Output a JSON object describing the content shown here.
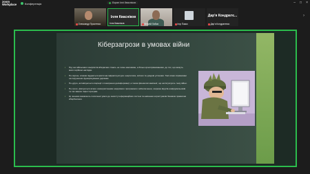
{
  "app": {
    "logo_line1": "zoom",
    "logo_line2": "Workplace",
    "meeting_label": "Конференція"
  },
  "share_notice": "Екран Іллі Квасніков",
  "participants": [
    {
      "name": "Олександр Простенко"
    },
    {
      "big_name": "Ілля Квасніков",
      "name": "Ілля Квасніков"
    },
    {
      "name": "Віталій Лобов"
    },
    {
      "name": "Ігор Пакко"
    },
    {
      "big_name": "Дар'я Кондратє...",
      "name": "Дар'я Кондратенко"
    }
  ],
  "slide": {
    "title": "Кіберзагрози в умовах війни",
    "bullets": [
      "Під час військових конфліктів кібератаки стають не лише масовими, а більш цілеспрямованими, до тих, що можуть мати серйозні наслідки.",
      "По-перше, атакам піддається критична інфраструктура: енергетика, зв'язок та урядові установи. Такі атаки спрямовані на порушення функціонування держави.",
      "По-друге, активізуються операції з поширення дезінформації, а також фішингові кампанії, що експлуатують тему війни.",
      "По-третє, фіксуються атаки з використанням шкідливого програмного забезпечення, зокрема вірусів-шифрувальників та так званих 'wiper'-програм.",
      "Ці чинники вимагають посиленої уваги до захисту інформаційних систем та навчання користувачів базовим правилам кібербезпеки."
    ]
  },
  "colors": {
    "active_border": "#2bbd4d",
    "slide_bg": "#2c3c36",
    "accent": "#a2c96b",
    "illustration_bg": "#c8b6d8"
  }
}
